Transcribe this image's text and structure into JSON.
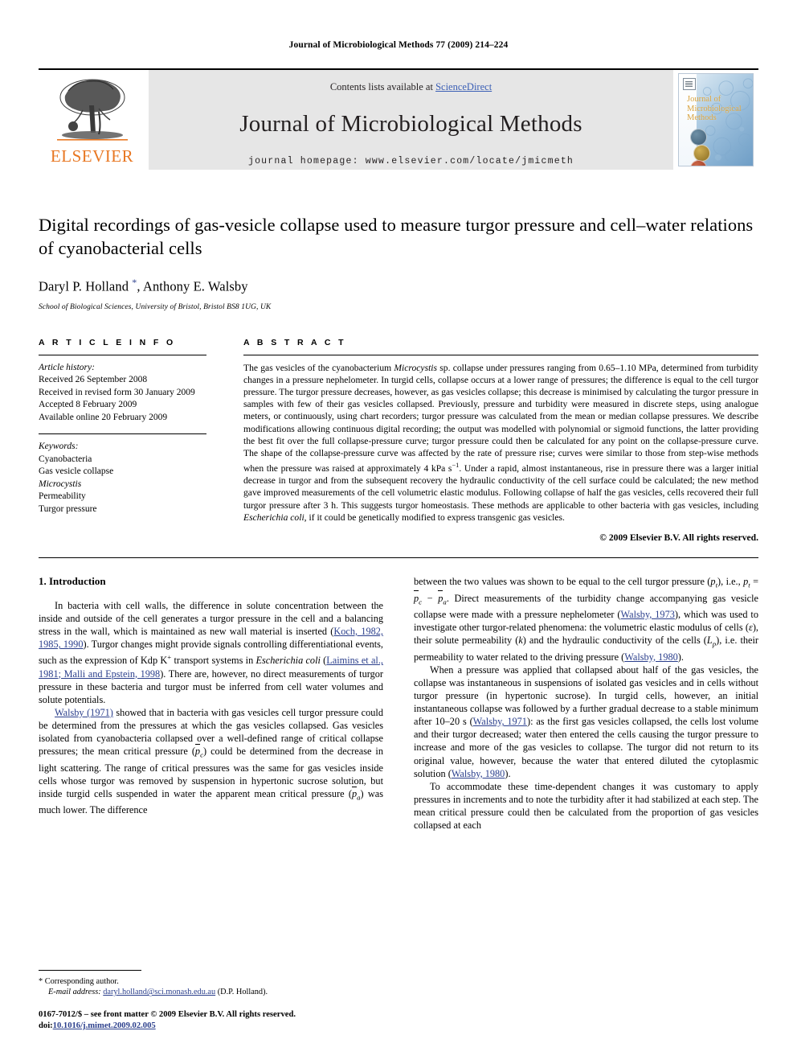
{
  "running_head": "Journal of Microbiological Methods 77 (2009) 214–224",
  "masthead": {
    "publisher": "ELSEVIER",
    "contents_prefix": "Contents lists available at ",
    "sciencedirect": "ScienceDirect",
    "journal_title": "Journal of Microbiological Methods",
    "homepage": "journal homepage: www.elsevier.com/locate/jmicmeth",
    "cover_title": "Journal of Microbiological Methods",
    "link_color": "#3b5fb5",
    "elsevier_orange": "#E87722"
  },
  "title_block": {
    "title": "Digital recordings of gas-vesicle collapse used to measure turgor pressure and cell–water relations of cyanobacterial cells",
    "authors_part1": "Daryl P. Holland ",
    "corresponding_mark": "*",
    "authors_part2": ", Anthony E. Walsby",
    "affiliation": "School of Biological Sciences, University of Bristol, Bristol BS8 1UG, UK"
  },
  "article_info": {
    "heading": "A R T I C L E    I N F O",
    "history_label": "Article history:",
    "history": [
      "Received 26 September 2008",
      "Received in revised form 30 January 2009",
      "Accepted 8 February 2009",
      "Available online 20 February 2009"
    ],
    "keywords_label": "Keywords:",
    "keywords": [
      {
        "text": "Cyanobacteria",
        "italic": false
      },
      {
        "text": "Gas vesicle collapse",
        "italic": false
      },
      {
        "text": "Microcystis",
        "italic": true
      },
      {
        "text": "Permeability",
        "italic": false
      },
      {
        "text": "Turgor pressure",
        "italic": false
      }
    ]
  },
  "abstract": {
    "heading": "A B S T R A C T",
    "text_1": "The gas vesicles of the cyanobacterium ",
    "italic_1": "Microcystis",
    "text_2": " sp. collapse under pressures ranging from 0.65–1.10 MPa, determined from turbidity changes in a pressure nephelometer. In turgid cells, collapse occurs at a lower range of pressures; the difference is equal to the cell turgor pressure. The turgor pressure decreases, however, as gas vesicles collapse; this decrease is minimised by calculating the turgor pressure in samples with few of their gas vesicles collapsed. Previously, pressure and turbidity were measured in discrete steps, using analogue meters, or continuously, using chart recorders; turgor pressure was calculated from the mean or median collapse pressures. We describe modifications allowing continuous digital recording; the output was modelled with polynomial or sigmoid functions, the latter providing the best fit over the full collapse-pressure curve; turgor pressure could then be calculated for any point on the collapse-pressure curve. The shape of the collapse-pressure curve was affected by the rate of pressure rise; curves were similar to those from step-wise methods when the pressure was raised at approximately 4 kPa s",
    "exponent_1": "−1",
    "text_3": ". Under a rapid, almost instantaneous, rise in pressure there was a larger initial decrease in turgor and from the subsequent recovery the hydraulic conductivity of the cell surface could be calculated; the new method gave improved measurements of the cell volumetric elastic modulus. Following collapse of half the gas vesicles, cells recovered their full turgor pressure after 3 h. This suggests turgor homeostasis. These methods are applicable to other bacteria with gas vesicles, including ",
    "italic_2": "Escherichia coli",
    "text_4": ", if it could be genetically modified to express transgenic gas vesicles.",
    "copyright": "© 2009 Elsevier B.V. All rights reserved."
  },
  "introduction": {
    "section_title": "1. Introduction",
    "left": {
      "p1_a": "In bacteria with cell walls, the difference in solute concentration between the inside and outside of the cell generates a turgor pressure in the cell and a balancing stress in the wall, which is maintained as new wall material is inserted (",
      "p1_ref1": "Koch, 1982, 1985, 1990",
      "p1_b": "). Turgor changes might provide signals controlling differentiational events, such as the expression of Kdp K",
      "p1_sup": "+",
      "p1_c": " transport systems in ",
      "p1_ital": "Escherichia coli",
      "p1_d": " (",
      "p1_ref2": "Laimins et al., 1981; Malli and Epstein, 1998",
      "p1_e": "). There are, however, no direct measurements of turgor pressure in these bacteria and turgor must be inferred from cell water volumes and solute potentials.",
      "p2_ref1": "Walsby (1971)",
      "p2_a": " showed that in bacteria with gas vesicles cell turgor pressure could be determined from the pressures at which the gas vesicles collapsed. Gas vesicles isolated from cyanobacteria collapsed over a well-defined range of critical collapse pressures; the mean critical pressure (",
      "p2_sym1": "p",
      "p2_sym1_sub": "c",
      "p2_b": ") could be determined from the decrease in light scattering. The range of critical pressures was the same for gas vesicles inside cells whose turgor was removed by suspension in hypertonic sucrose solution, but inside turgid cells suspended in water the apparent mean critical pressure (",
      "p2_sym2": "p",
      "p2_sym2_sub": "a",
      "p2_c": ") was much lower. The difference"
    },
    "right": {
      "p3_a": "between the two values was shown to be equal to the cell turgor pressure (",
      "p3_sym_pt": "p",
      "p3_sym_pt_sub": "t",
      "p3_b": "), i.e., ",
      "p3_eq_pt": "p",
      "p3_eq_pt_sub": "t",
      "p3_eq_mid": " = ",
      "p3_eq_pc": "p",
      "p3_eq_pc_sub": "c",
      "p3_eq_minus": " − ",
      "p3_eq_pa": "p",
      "p3_eq_pa_sub": "a",
      "p3_c": ". Direct measurements of the turbidity change accompanying gas vesicle collapse were made with a pressure nephelometer (",
      "p3_ref1": "Walsby, 1973",
      "p3_d": "), which was used to investigate other turgor-related phenomena: the volumetric elastic modulus of cells (",
      "p3_sym_e": "ε",
      "p3_e": "), their solute permeability (",
      "p3_sym_k": "k",
      "p3_f": ") and the hydraulic conductivity of the cells (",
      "p3_sym_lp": "L",
      "p3_sym_lp_sub": "p",
      "p3_g": "), i.e. their permeability to water related to the driving pressure (",
      "p3_ref2": "Walsby, 1980",
      "p3_h": ").",
      "p4_a": "When a pressure was applied that collapsed about half of the gas vesicles, the collapse was instantaneous in suspensions of isolated gas vesicles and in cells without turgor pressure (in hypertonic sucrose). In turgid cells, however, an initial instantaneous collapse was followed by a further gradual decrease to a stable minimum after 10–20 s (",
      "p4_ref1": "Walsby, 1971",
      "p4_b": "): as the first gas vesicles collapsed, the cells lost volume and their turgor decreased; water then entered the cells causing the turgor pressure to increase and more of the gas vesicles to collapse. The turgor did not return to its original value, however, because the water that entered diluted the cytoplasmic solution (",
      "p4_ref2": "Walsby, 1980",
      "p4_c": ").",
      "p5_a": "To accommodate these time-dependent changes it was customary to apply pressures in increments and to note the turbidity after it had stabilized at each step. The mean critical pressure could then be calculated from the proportion of gas vesicles collapsed at each"
    }
  },
  "footnotes": {
    "corresponding_star": "*",
    "corresponding_text": " Corresponding author.",
    "email_label": "E-mail address:",
    "email": "daryl.holland@sci.monash.edu.au",
    "email_suffix": " (D.P. Holland).",
    "issn_line": "0167-7012/$ – see front matter © 2009 Elsevier B.V. All rights reserved.",
    "doi_label": "doi:",
    "doi_value": "10.1016/j.mimet.2009.02.005"
  }
}
